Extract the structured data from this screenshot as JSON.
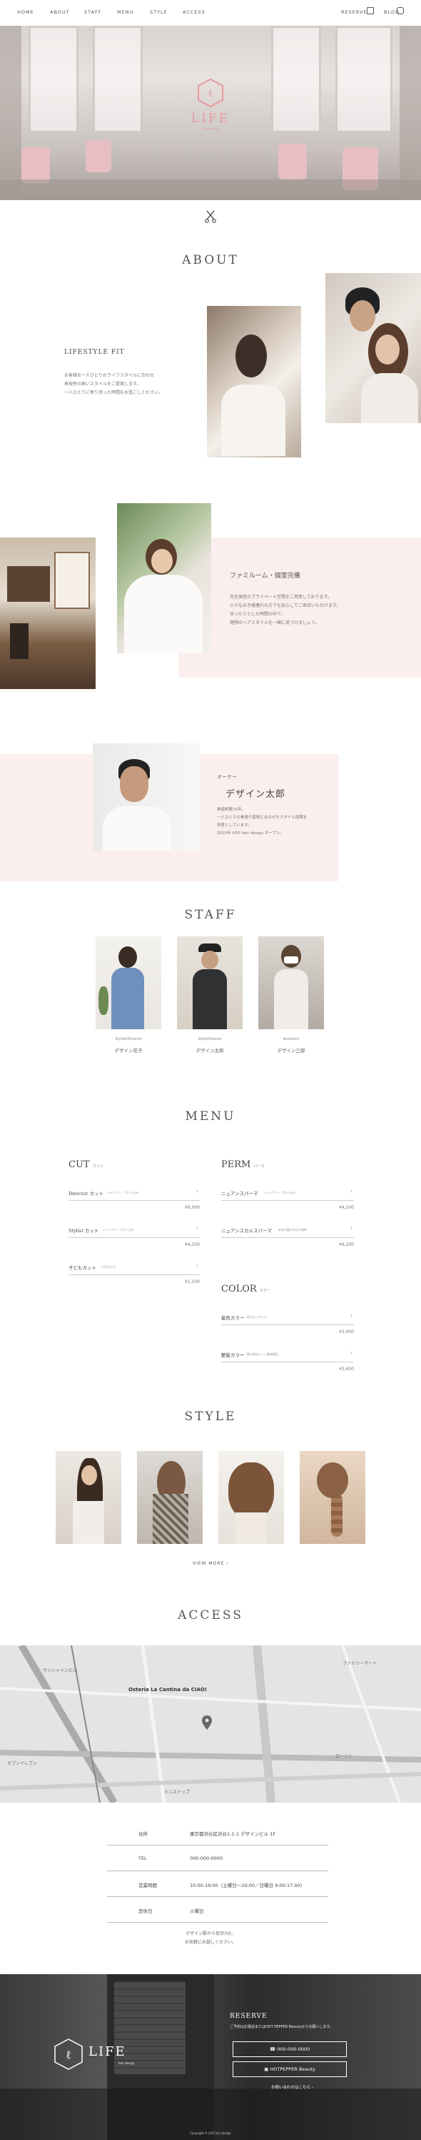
{
  "nav": {
    "items": [
      "HOME",
      "ABOUT",
      "STAFF",
      "MENU",
      "STYLE",
      "ACCESS"
    ],
    "reserve": "RESERVE",
    "blog": "BLOG"
  },
  "brand": {
    "name": "LIFE",
    "sub": "hair design"
  },
  "about": {
    "title": "ABOUT",
    "block1": {
      "heading": "LIFESTYLE FIT",
      "text": [
        "お客様お一人ひとりのライフスタイルに合わせ",
        "再現性の高いスタイルをご提案します。",
        "一人ひとりに寄り添った時間をお過ごしください。"
      ]
    },
    "block2": {
      "heading": "ファミルーム・個室完備",
      "text": [
        "完全個室のプライベート空間をご用意しております。",
        "小さなお子様連れの方でも安心してご来店いただけます。",
        "",
        "ゆったりとした時間の中で、",
        "理想のヘアスタイルを一緒に見つけましょう。"
      ]
    },
    "owner": {
      "role": "オーナー",
      "name": "デザイン太郎",
      "text": [
        "美容師歴15年。",
        "一人ひとりの骨格や髪質に合わせたスタイル提案を",
        "得意としています。",
        "2015年 LIFE hair design オープン。"
      ]
    }
  },
  "staff": {
    "title": "STAFF",
    "members": [
      {
        "role": "Stylist/Director",
        "name": "デザイン花子"
      },
      {
        "role": "Stylist/Owner",
        "name": "デザイン太郎"
      },
      {
        "role": "Assistant",
        "name": "デザイン三郎"
      }
    ]
  },
  "menu": {
    "title": "MENU",
    "cut": {
      "heading": "CUT",
      "sub": "カット",
      "items": [
        {
          "name": "Director カット",
          "note": "シャンプー・ブロー込み",
          "price": "¥6,000"
        },
        {
          "name": "Stylist カット",
          "note": "シャンプー・ブロー込み",
          "price": "¥4,200"
        },
        {
          "name": "子どもカット",
          "note": "小学生以下",
          "price": "¥1,100"
        }
      ]
    },
    "perm": {
      "heading": "PERM",
      "sub": "パーマ",
      "items": [
        {
          "name": "ニュアンスパーマ",
          "note": "シャンプー・ブロー込み",
          "price": "¥4,200"
        },
        {
          "name": "ニュアンスカルスパーマ",
          "note": "毛先の動きを出す施術",
          "price": "¥6,200"
        }
      ]
    },
    "color": {
      "heading": "COLOR",
      "sub": "カラー",
      "items": [
        {
          "name": "髪色カラー",
          "note": "根元のリタッチ",
          "price": "¥3,000"
        },
        {
          "name": "艶髪カラー",
          "note": "髪を傷めにくい薬剤使用",
          "price": "¥3,600"
        }
      ]
    }
  },
  "style": {
    "title": "STYLE",
    "more": "VIEW MORE"
  },
  "access": {
    "title": "ACCESS",
    "map_labels": [
      "Osteria La Cantina da CIAO!",
      "サンシャインビル",
      "ファミリーマート",
      "セブンイレブン",
      "ミニストップ",
      "ローソン"
    ],
    "rows": [
      {
        "label": "住所",
        "value": "東京都渋谷区渋谷1-1-1 デザインビル 1F"
      },
      {
        "label": "TEL",
        "value": "000-000-0000"
      },
      {
        "label": "営業時間",
        "value": "10:00-19:00（土曜日〜20:00／日曜日 9:00-17:00）"
      },
      {
        "label": "定休日",
        "value": "火曜日"
      }
    ],
    "note": [
      "デザイン駅から徒歩3分。",
      "お気軽にお越しください。"
    ]
  },
  "footer": {
    "reserve": "RESERVE",
    "reserve_note": "ご予約はお電話またはHOT PEPPER Beautyからお願いします。",
    "tel": "000-000-0000",
    "hotpepper": "HOTPEPPER Beauty",
    "contact": "お問い合わせはこちら",
    "copyright": "Copyright © LIFE hair design"
  },
  "colors": {
    "pink": "#fbeeee",
    "accent": "#e79a9f",
    "dark": "#333333"
  }
}
